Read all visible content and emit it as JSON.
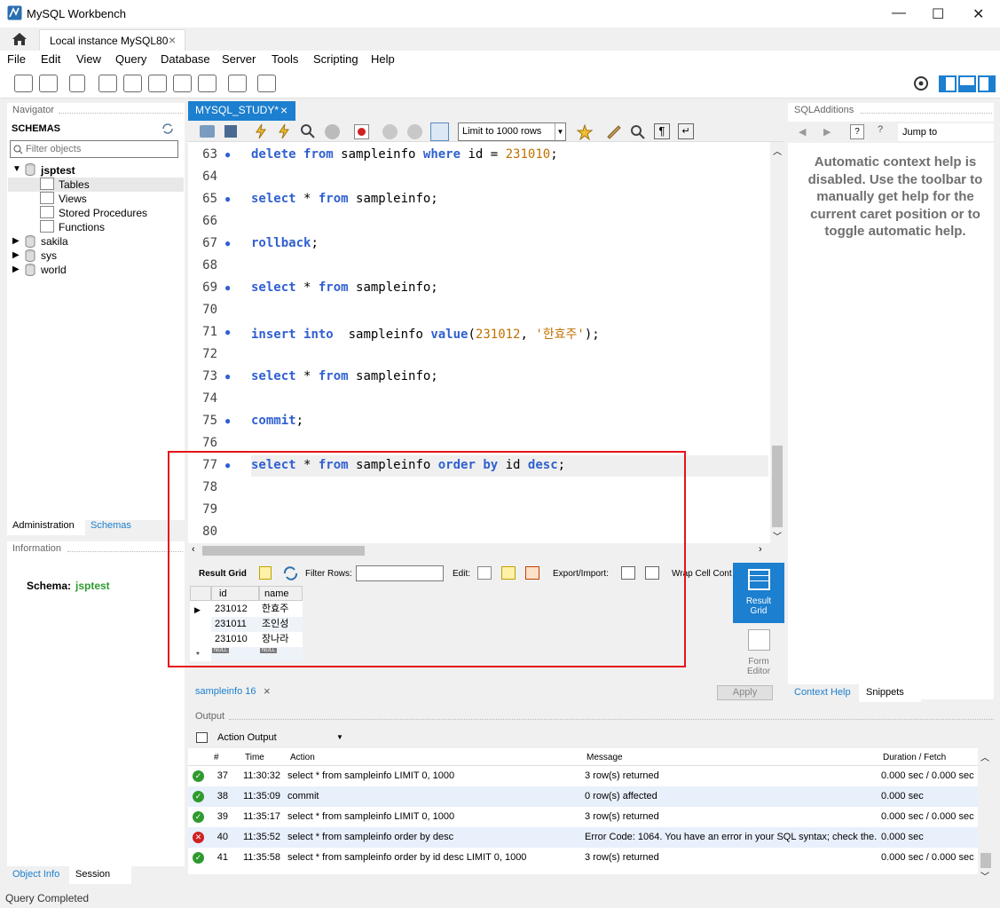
{
  "window": {
    "title": "MySQL Workbench",
    "minimize": "—",
    "maximize": "☐",
    "close": "✕"
  },
  "connection_tab": {
    "label": "Local instance MySQL80",
    "close": "×"
  },
  "menu": [
    "File",
    "Edit",
    "View",
    "Query",
    "Database",
    "Server",
    "Tools",
    "Scripting",
    "Help"
  ],
  "navigator": {
    "header": "Navigator",
    "schemas_title": "SCHEMAS",
    "filter_placeholder": "Filter objects",
    "tree": [
      {
        "name": "jsptest",
        "expanded": true,
        "children": [
          "Tables",
          "Views",
          "Stored Procedures",
          "Functions"
        ]
      },
      {
        "name": "sakila"
      },
      {
        "name": "sys"
      },
      {
        "name": "world"
      }
    ],
    "tabs": [
      "Administration",
      "Schemas"
    ]
  },
  "information": {
    "header": "Information",
    "schema_label": "Schema:",
    "schema_value": "jsptest",
    "tabs": [
      "Object Info",
      "Session"
    ]
  },
  "editor_tab": {
    "label": "MYSQL_STUDY*",
    "close": "×"
  },
  "editor_toolbar": {
    "limit_select": "Limit to 1000 rows"
  },
  "code_lines": [
    {
      "n": "63",
      "tokens": [
        [
          "kw",
          "delete"
        ],
        [
          "t",
          " "
        ],
        [
          "kw",
          "from"
        ],
        [
          "t",
          " sampleinfo "
        ],
        [
          "kw",
          "where"
        ],
        [
          "t",
          " id = "
        ],
        [
          "num",
          "231010"
        ],
        [
          "t",
          ";"
        ]
      ]
    },
    {
      "n": "64",
      "tokens": []
    },
    {
      "n": "65",
      "tokens": [
        [
          "kw",
          "select"
        ],
        [
          "t",
          " * "
        ],
        [
          "kw",
          "from"
        ],
        [
          "t",
          " sampleinfo;"
        ]
      ]
    },
    {
      "n": "66",
      "tokens": []
    },
    {
      "n": "67",
      "tokens": [
        [
          "kw",
          "rollback"
        ],
        [
          "t",
          ";"
        ]
      ]
    },
    {
      "n": "68",
      "tokens": []
    },
    {
      "n": "69",
      "tokens": [
        [
          "kw",
          "select"
        ],
        [
          "t",
          " * "
        ],
        [
          "kw",
          "from"
        ],
        [
          "t",
          " sampleinfo;"
        ]
      ]
    },
    {
      "n": "70",
      "tokens": []
    },
    {
      "n": "71",
      "tokens": [
        [
          "kw",
          "insert"
        ],
        [
          "t",
          " "
        ],
        [
          "kw",
          "into"
        ],
        [
          "t",
          "  sampleinfo "
        ],
        [
          "kw",
          "value"
        ],
        [
          "t",
          "("
        ],
        [
          "num",
          "231012"
        ],
        [
          "t",
          ", "
        ],
        [
          "str",
          "'한효주'"
        ],
        [
          "t",
          ");"
        ]
      ]
    },
    {
      "n": "72",
      "tokens": []
    },
    {
      "n": "73",
      "tokens": [
        [
          "kw",
          "select"
        ],
        [
          "t",
          " * "
        ],
        [
          "kw",
          "from"
        ],
        [
          "t",
          " sampleinfo;"
        ]
      ]
    },
    {
      "n": "74",
      "tokens": []
    },
    {
      "n": "75",
      "tokens": [
        [
          "kw",
          "commit"
        ],
        [
          "t",
          ";"
        ]
      ]
    },
    {
      "n": "76",
      "tokens": []
    },
    {
      "n": "77",
      "tokens": [
        [
          "kw",
          "select"
        ],
        [
          "t",
          " * "
        ],
        [
          "kw",
          "from"
        ],
        [
          "t",
          " sampleinfo "
        ],
        [
          "kw",
          "order"
        ],
        [
          "t",
          " "
        ],
        [
          "kw",
          "by"
        ],
        [
          "t",
          " id "
        ],
        [
          "kw",
          "desc"
        ],
        [
          "t",
          ";"
        ]
      ]
    },
    {
      "n": "78",
      "tokens": []
    },
    {
      "n": "79",
      "tokens": []
    },
    {
      "n": "80",
      "tokens": []
    }
  ],
  "result_toolbar": {
    "result_grid": "Result Grid",
    "filter_rows": "Filter Rows:",
    "edit": "Edit:",
    "export_import": "Export/Import:",
    "wrap": "Wrap Cell Cont"
  },
  "result_grid": {
    "columns": [
      "id",
      "name"
    ],
    "rows": [
      [
        "231012",
        "한효주"
      ],
      [
        "231011",
        "조인성"
      ],
      [
        "231010",
        "장나라"
      ]
    ],
    "null_label": "NULL"
  },
  "side_buttons": {
    "result_grid": "Result\nGrid",
    "form_editor": "Form\nEditor",
    "apply": "Apply"
  },
  "result_tab": {
    "label": "sampleinfo 16",
    "close": "×"
  },
  "sql_additions": {
    "header": "SQLAdditions",
    "jump_to": "Jump to",
    "help_text": "Automatic context help is disabled. Use the toolbar to manually get help for the current caret position or to toggle automatic help.",
    "tabs": [
      "Context Help",
      "Snippets"
    ]
  },
  "output": {
    "header": "Output",
    "selector": "Action Output",
    "columns": [
      "#",
      "Time",
      "Action",
      "Message",
      "Duration / Fetch"
    ],
    "rows": [
      {
        "status": "ok",
        "n": "37",
        "time": "11:30:32",
        "action": "select * from sampleinfo LIMIT 0, 1000",
        "message": "3 row(s) returned",
        "duration": "0.000 sec / 0.000 sec"
      },
      {
        "status": "ok",
        "n": "38",
        "time": "11:35:09",
        "action": "commit",
        "message": "0 row(s) affected",
        "duration": "0.000 sec"
      },
      {
        "status": "ok",
        "n": "39",
        "time": "11:35:17",
        "action": "select * from sampleinfo LIMIT 0, 1000",
        "message": "3 row(s) returned",
        "duration": "0.000 sec / 0.000 sec"
      },
      {
        "status": "error",
        "n": "40",
        "time": "11:35:52",
        "action": "select * from sampleinfo order by desc",
        "message": "Error Code: 1064. You have an error in your SQL syntax; check the...",
        "duration": "0.000 sec"
      },
      {
        "status": "ok",
        "n": "41",
        "time": "11:35:58",
        "action": "select * from sampleinfo order by id desc LIMIT 0, 1000",
        "message": "3 row(s) returned",
        "duration": "0.000 sec / 0.000 sec"
      }
    ]
  },
  "status": {
    "text": "Query Completed"
  },
  "colors": {
    "accent": "#1c7fcf",
    "ok": "#2e9a2e",
    "error": "#d02020",
    "highlight": "#e4141a"
  }
}
